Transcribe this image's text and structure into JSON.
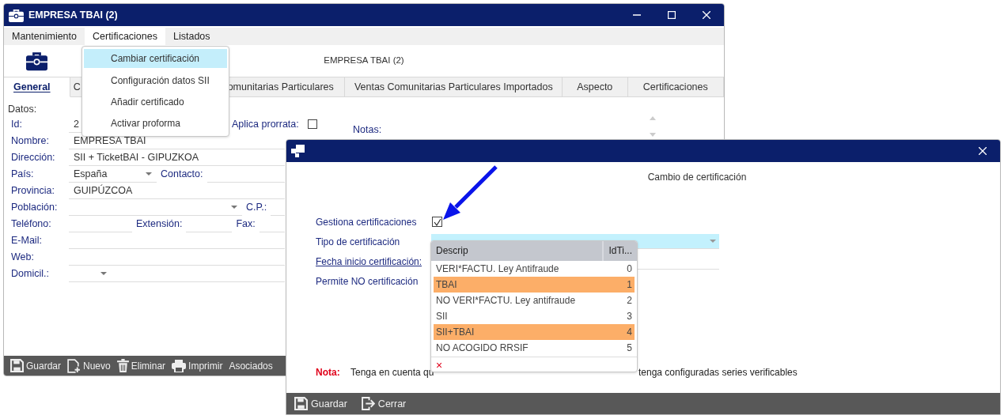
{
  "main_window": {
    "title": "EMPRESA TBAI (2)",
    "menu": [
      {
        "label": "Mantenimiento",
        "open": false
      },
      {
        "label": "Certificaciones",
        "open": true
      },
      {
        "label": "Listados",
        "open": false
      }
    ],
    "menu_popup": [
      {
        "label": "Cambiar certificación",
        "selected": true
      },
      {
        "label": "Configuración datos SII",
        "selected": false
      },
      {
        "label": "Añadir certificado",
        "selected": false
      },
      {
        "label": "Activar proforma",
        "selected": false
      }
    ],
    "header_title": "EMPRESA TBAI (2)",
    "tabs": [
      {
        "label": "General",
        "selected": true
      },
      {
        "label": "C",
        "selected": false
      },
      {
        "label": "omunitarias Particulares",
        "selected": false
      },
      {
        "label": "Ventas Comunitarias Particulares Importados",
        "selected": false
      },
      {
        "label": "Aspecto",
        "selected": false
      },
      {
        "label": "Certificaciones",
        "selected": false
      }
    ],
    "section_label": "Datos:",
    "rows": [
      {
        "label": "Id:",
        "items": [
          {
            "kind": "field",
            "value": "2"
          },
          {
            "kind": "label",
            "text": "Aplica prorrata:"
          },
          {
            "kind": "checkbox",
            "checked": false
          }
        ]
      },
      {
        "label": "Nombre:",
        "items": [
          {
            "kind": "field",
            "value": "EMPRESA TBAI"
          }
        ]
      },
      {
        "label": "Dirección:",
        "items": [
          {
            "kind": "field",
            "value": "SII + TicketBAI - GIPUZKOA"
          }
        ]
      },
      {
        "label": "País:",
        "items": [
          {
            "kind": "combo",
            "value": "España"
          },
          {
            "kind": "label",
            "text": "Contacto:"
          },
          {
            "kind": "field"
          }
        ]
      },
      {
        "label": "Provincia:",
        "items": [
          {
            "kind": "field",
            "value": "GUIPÚZCOA"
          }
        ]
      },
      {
        "label": "Población:",
        "items": [
          {
            "kind": "combo"
          },
          {
            "kind": "label",
            "text": "C.P.:"
          },
          {
            "kind": "field"
          }
        ]
      },
      {
        "label": "Teléfono:",
        "items": [
          {
            "kind": "field"
          },
          {
            "kind": "label",
            "text": "Extensión:"
          },
          {
            "kind": "field"
          },
          {
            "kind": "label",
            "text": "Fax:"
          },
          {
            "kind": "field"
          }
        ]
      },
      {
        "label": "E-Mail:",
        "items": [
          {
            "kind": "field"
          }
        ]
      },
      {
        "label": "Web:",
        "items": [
          {
            "kind": "field"
          }
        ]
      },
      {
        "label": "Domicil.:",
        "items": [
          {
            "kind": "combo"
          },
          {
            "kind": "field"
          }
        ]
      }
    ],
    "notes_label": "Notas:",
    "toolbar": [
      {
        "kind": "save",
        "label": "Guardar"
      },
      {
        "kind": "new",
        "label": "Nuevo"
      },
      {
        "kind": "delete",
        "label": "Eliminar"
      },
      {
        "kind": "print",
        "label": "Imprimir"
      },
      {
        "kind": "plain",
        "label": "Asociados"
      }
    ]
  },
  "dialog": {
    "subtitle": "Cambio de certificación",
    "fields": [
      {
        "kind": "checkbox",
        "label": "Gestiona certificaciones",
        "checked": true
      },
      {
        "kind": "combo",
        "label": "Tipo de certificación"
      },
      {
        "kind": "date",
        "label": "Fecha inicio certificación:"
      },
      {
        "kind": "text",
        "label": "Permite NO certificación"
      }
    ],
    "note": {
      "label": "Nota:",
      "text_before": "Tenga en cuenta qu",
      "text_after": "tenga configuradas series verificables"
    },
    "grid": {
      "columns": [
        "Descrip",
        "IdTi..."
      ],
      "rows": [
        {
          "cells": [
            "VERI*FACTU. Ley Antifraude",
            "0"
          ],
          "highlighted": false
        },
        {
          "cells": [
            "TBAI",
            "1"
          ],
          "highlighted": true
        },
        {
          "cells": [
            "NO VERI*FACTU. Ley antifraude",
            "2"
          ],
          "highlighted": false
        },
        {
          "cells": [
            "SII",
            "3"
          ],
          "highlighted": false
        },
        {
          "cells": [
            "SII+TBAI",
            "4"
          ],
          "highlighted": true
        },
        {
          "cells": [
            "NO ACOGIDO RRSIF",
            "5"
          ],
          "highlighted": false
        }
      ],
      "clear": "×"
    },
    "toolbar": [
      {
        "kind": "save",
        "label": "Guardar"
      },
      {
        "kind": "exit",
        "label": "Cerrar"
      }
    ]
  }
}
